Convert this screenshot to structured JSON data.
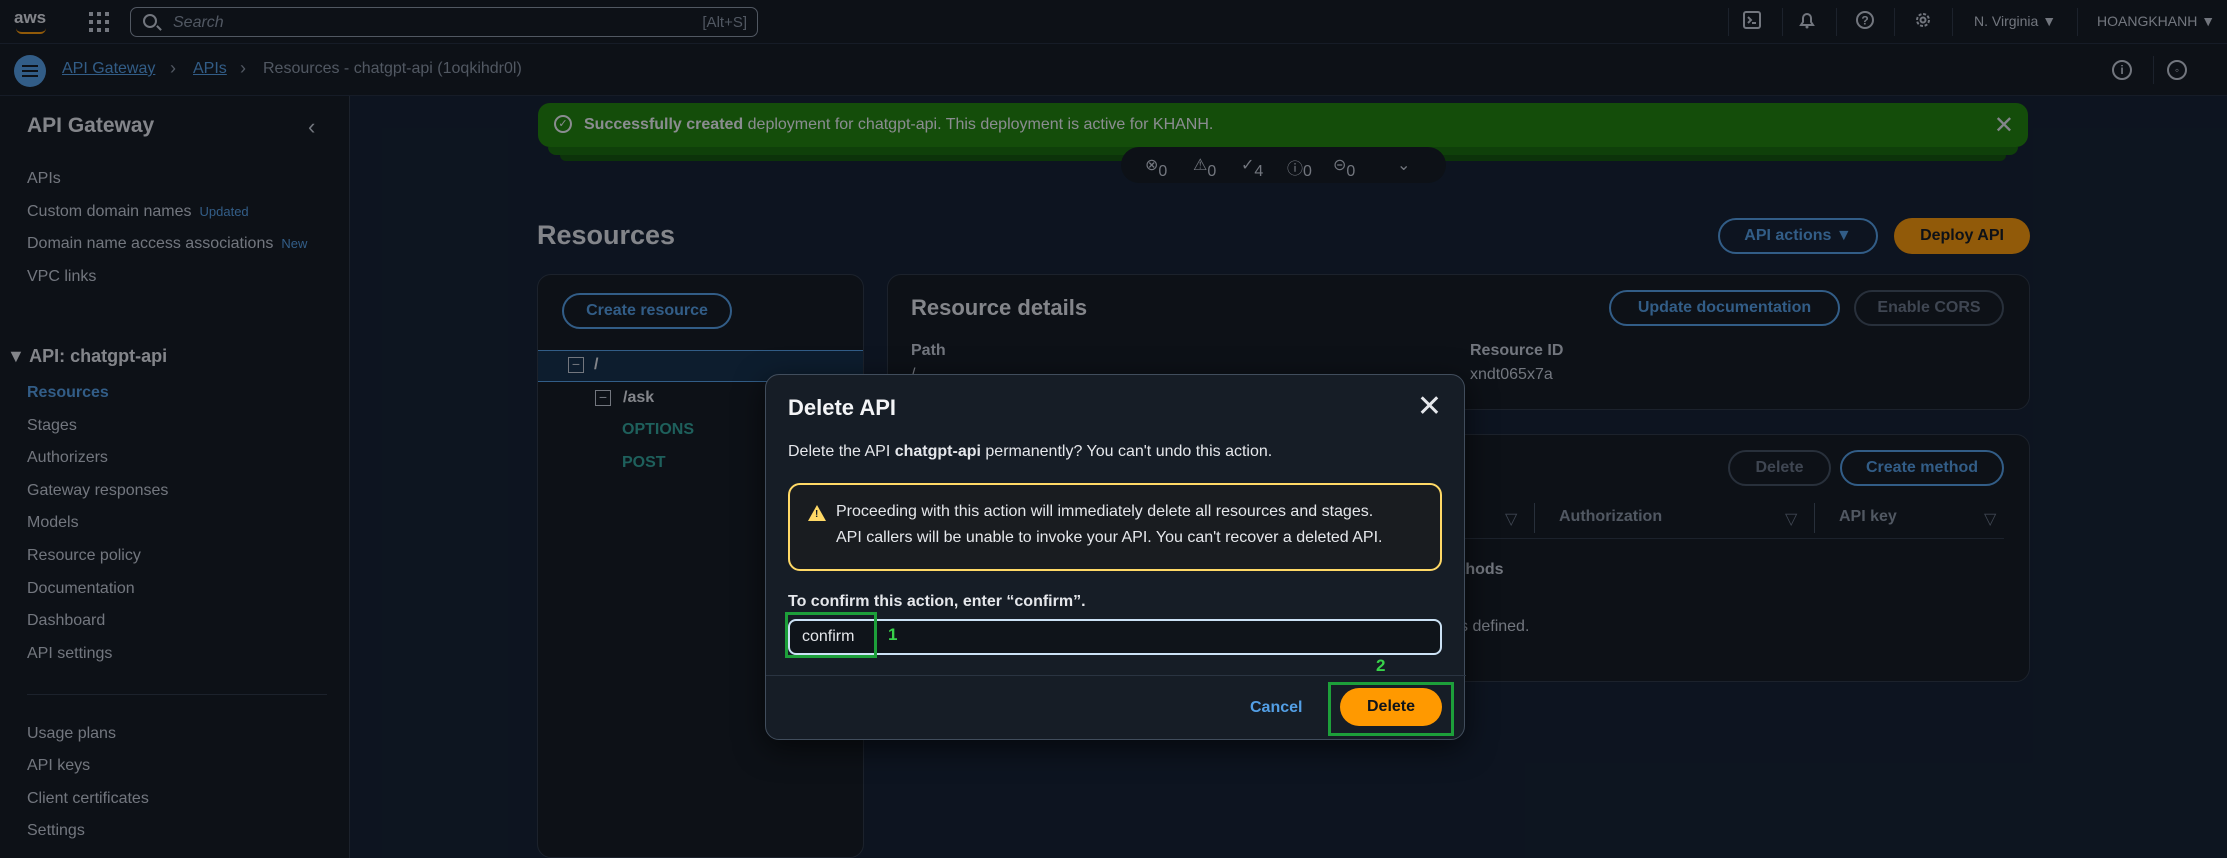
{
  "topbar": {
    "logo": "aws",
    "search_placeholder": "Search",
    "search_shortcut": "[Alt+S]",
    "region": "N. Virginia ▼",
    "user": "HOANGKHANH ▼",
    "icons": [
      "cloudshell-icon",
      "bell-icon",
      "help-icon",
      "gear-icon"
    ]
  },
  "breadcrumb": {
    "items": [
      "API Gateway",
      "APIs",
      "Resources - chatgpt-api (1oqkihdr0l)"
    ]
  },
  "sidebar": {
    "title": "API Gateway",
    "top_items": [
      {
        "label": "APIs",
        "badge": ""
      },
      {
        "label": "Custom domain names",
        "badge": "Updated"
      },
      {
        "label": "Domain name access associations",
        "badge": "New"
      },
      {
        "label": "VPC links",
        "badge": ""
      }
    ],
    "section": "▼ API: chatgpt-api",
    "api_items": [
      "Resources",
      "Stages",
      "Authorizers",
      "Gateway responses",
      "Models",
      "Resource policy",
      "Documentation",
      "Dashboard",
      "API settings"
    ],
    "bottom_items": [
      "Usage plans",
      "API keys",
      "Client certificates",
      "Settings"
    ]
  },
  "flash": {
    "bold": "Successfully created",
    "text": " deployment for chatgpt-api. This deployment is active for KHANH.",
    "counts": [
      "0",
      "0",
      "4",
      "0",
      "0"
    ]
  },
  "main": {
    "title": "Resources",
    "api_actions": "API actions ▼",
    "deploy_api": "Deploy API",
    "create_resource": "Create resource",
    "tree": {
      "root": "/",
      "child": "/ask",
      "methods": [
        "OPTIONS",
        "POST"
      ]
    },
    "details_title": "Resource details",
    "update_doc": "Update documentation",
    "enable_cors": "Enable CORS",
    "path_label": "Path",
    "path_value": "/",
    "resource_id_label": "Resource ID",
    "resource_id_value": "xndt065x7a",
    "delete_label": "Delete",
    "create_method": "Create method",
    "col_authorization": "Authorization",
    "col_api_key": "API key",
    "frag_methods": "thods",
    "frag_defined": "s defined."
  },
  "modal": {
    "title": "Delete API",
    "desc_pre": "Delete the API ",
    "desc_name": "chatgpt-api",
    "desc_post": " permanently? You can't undo this action.",
    "warn_line1": "Proceeding with this action will immediately delete all resources and stages.",
    "warn_line2": "API callers will be unable to invoke your API. You can't recover a deleted API.",
    "confirm_label": "To confirm this action, enter “confirm”.",
    "confirm_value": "confirm",
    "cancel": "Cancel",
    "delete": "Delete"
  },
  "annotations": {
    "step1": "1",
    "step2": "2"
  }
}
